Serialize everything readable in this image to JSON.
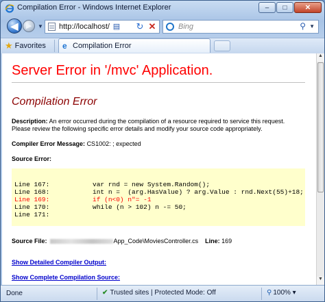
{
  "window": {
    "title": "Compilation Error - Windows Internet Explorer",
    "minimize_label": "–",
    "maximize_label": "□",
    "close_label": "✕"
  },
  "nav": {
    "back_glyph": "◀",
    "forward_glyph": "▶",
    "address_value": "http://localhost/",
    "refresh_glyph": "↻",
    "stop_glyph": "✕",
    "search_placeholder": "Bing",
    "search_glyph": "⚲"
  },
  "favorites": {
    "label": "Favorites",
    "star_glyph": "★"
  },
  "tab": {
    "title": "Compilation Error",
    "icon_glyph": "e"
  },
  "page": {
    "heading": "Server Error in '/mvc' Application.",
    "subheading": "Compilation Error",
    "description_label": "Description:",
    "description_text": "An error occurred during the compilation of a resource required to service this request. Please review the following specific error details and modify your source code appropriately.",
    "compiler_label": "Compiler Error Message:",
    "compiler_value": "CS1002: ; expected",
    "source_error_label": "Source Error:",
    "code_lines": [
      {
        "text": "Line 167:           var rnd = new System.Random();",
        "error": false
      },
      {
        "text": "Line 168:           int n =  (arg.HasValue) ? arg.Value : rnd.Next(55)+18;",
        "error": false
      },
      {
        "text": "Line 169:           if (n<0) n\"= -1",
        "error": true
      },
      {
        "text": "Line 170:           while (n > 102) n -= 50;",
        "error": false
      },
      {
        "text": "Line 171:",
        "error": false
      }
    ],
    "source_file_label": "Source File:",
    "source_file_path": "App_Code\\MoviesController.cs",
    "line_label": "Line:",
    "line_value": "169",
    "link_compiler_output": "Show Detailed Compiler Output:",
    "link_compilation_source": "Show Complete Compilation Source:"
  },
  "status": {
    "text": "Done",
    "zone": "Trusted sites | Protected Mode: Off",
    "zoom": "100%"
  },
  "colors": {
    "heading": "#ff0000",
    "subheading": "#8b0000",
    "code_background": "#ffffcc",
    "link": "#0000cc"
  }
}
